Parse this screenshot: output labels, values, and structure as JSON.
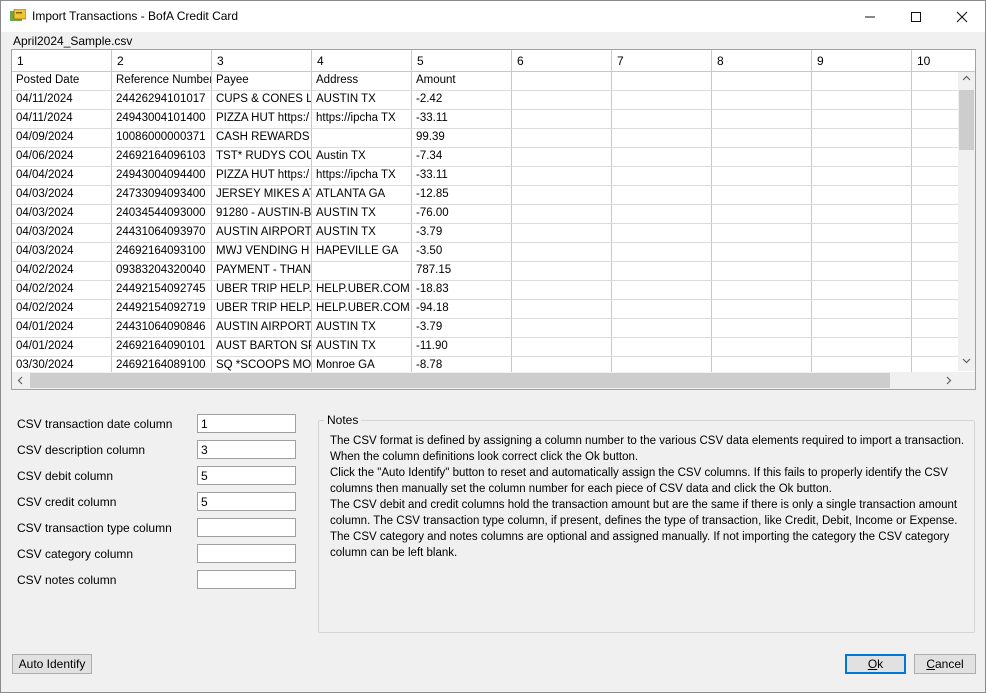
{
  "window": {
    "title": "Import Transactions - BofA Credit Card",
    "minimize": "—",
    "maximize": "☐",
    "close": "✕"
  },
  "file": {
    "name": "April2024_Sample.csv"
  },
  "grid": {
    "column_numbers": [
      "1",
      "2",
      "3",
      "4",
      "5",
      "6",
      "7",
      "8",
      "9",
      "10"
    ],
    "rows": [
      [
        "Posted Date",
        "Reference Number",
        "Payee",
        "Address",
        "Amount",
        "",
        "",
        "",
        "",
        ""
      ],
      [
        "04/11/2024",
        "24426294101017",
        "CUPS & CONES L",
        "AUSTIN        TX",
        "-2.42",
        "",
        "",
        "",
        "",
        ""
      ],
      [
        "04/11/2024",
        "24943004101400",
        "PIZZA HUT https:/",
        "https://ipcha TX",
        "-33.11",
        "",
        "",
        "",
        "",
        ""
      ],
      [
        "04/09/2024",
        "10086000000371",
        "CASH REWARDS S",
        "",
        "99.39",
        "",
        "",
        "",
        "",
        ""
      ],
      [
        "04/06/2024",
        "24692164096103",
        "TST* RUDYS COU",
        "Austin        TX",
        "-7.34",
        "",
        "",
        "",
        "",
        ""
      ],
      [
        "04/04/2024",
        "24943004094400",
        "PIZZA HUT https:/",
        "https://ipcha TX",
        "-33.11",
        "",
        "",
        "",
        "",
        ""
      ],
      [
        "04/03/2024",
        "24733094093400",
        "JERSEY MIKES ATL",
        "ATLANTA       GA",
        "-12.85",
        "",
        "",
        "",
        "",
        ""
      ],
      [
        "04/03/2024",
        "24034544093000",
        "91280 - AUSTIN-B",
        "AUSTIN        TX",
        "-76.00",
        "",
        "",
        "",
        "",
        ""
      ],
      [
        "04/03/2024",
        "24431064093970",
        "AUSTIN AIRPORT-",
        "AUSTIN        TX",
        "-3.79",
        "",
        "",
        "",
        "",
        ""
      ],
      [
        "04/03/2024",
        "24692164093100",
        "MWJ VENDING H",
        "HAPEVILLE     GA",
        "-3.50",
        "",
        "",
        "",
        "",
        ""
      ],
      [
        "04/02/2024",
        "09383204320040",
        "PAYMENT - THAN",
        "",
        "787.15",
        "",
        "",
        "",
        "",
        ""
      ],
      [
        "04/02/2024",
        "24492154092745",
        "UBER TRIP HELP.U",
        "HELP.UBER.COM C",
        "-18.83",
        "",
        "",
        "",
        "",
        ""
      ],
      [
        "04/02/2024",
        "24492154092719",
        "UBER TRIP HELP.U",
        "HELP.UBER.COM C",
        "-94.18",
        "",
        "",
        "",
        "",
        ""
      ],
      [
        "04/01/2024",
        "24431064090846",
        "AUSTIN AIRPORT-",
        "AUSTIN        TX",
        "-3.79",
        "",
        "",
        "",
        "",
        ""
      ],
      [
        "04/01/2024",
        "24692164090101",
        "AUST BARTON SP",
        "AUSTIN        TX",
        "-11.90",
        "",
        "",
        "",
        "",
        ""
      ],
      [
        "03/30/2024",
        "24692164089100",
        "SQ *SCOOPS MO",
        "Monroe        GA",
        "-8.78",
        "",
        "",
        "",
        "",
        ""
      ]
    ],
    "scroll_up": "^",
    "scroll_down": "v",
    "scroll_left": "<",
    "scroll_right": ">"
  },
  "fields": [
    {
      "label": "CSV transaction date column",
      "value": "1"
    },
    {
      "label": "CSV description column",
      "value": "3"
    },
    {
      "label": "CSV debit column",
      "value": "5"
    },
    {
      "label": "CSV credit column",
      "value": "5"
    },
    {
      "label": "CSV transaction type column",
      "value": ""
    },
    {
      "label": "CSV category column",
      "value": ""
    },
    {
      "label": "CSV notes column",
      "value": ""
    }
  ],
  "notes": {
    "title": "Notes",
    "paragraphs": [
      " The CSV format is defined by assigning a column number to the various CSV data elements required to import a transaction. When the column definitions look correct click the Ok button.",
      " Click the \"Auto Identify\" button to reset and automatically assign the CSV columns. If this fails to properly identify the CSV columns then manually set the column number for each piece of CSV data and click the Ok button.",
      " The CSV debit and credit columns hold the transaction amount but are the same if there is only a single transaction amount column. The CSV transaction type column, if present, defines the type of transaction, like Credit, Debit, Income or Expense. The CSV category and notes columns are optional and assigned manually. If not importing the category the CSV category column can be left blank."
    ]
  },
  "buttons": {
    "auto_identify": "Auto Identify",
    "ok_accel": "O",
    "ok_rest": "k",
    "cancel_accel": "C",
    "cancel_rest": "ancel"
  }
}
